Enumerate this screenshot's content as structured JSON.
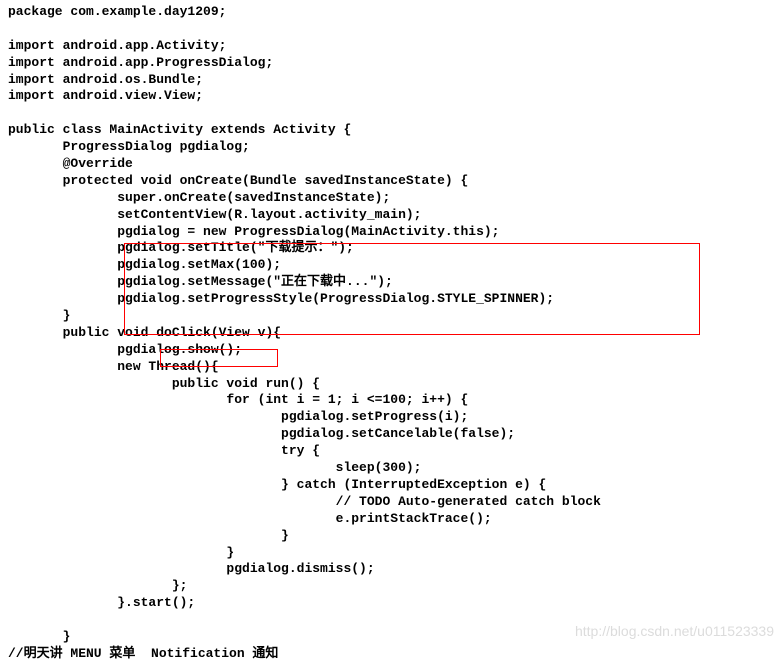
{
  "code": {
    "l1": "package com.example.day1209;",
    "l2": "",
    "l3": "import android.app.Activity;",
    "l4": "import android.app.ProgressDialog;",
    "l5": "import android.os.Bundle;",
    "l6": "import android.view.View;",
    "l7": "",
    "l8": "public class MainActivity extends Activity {",
    "l9": "       ProgressDialog pgdialog;",
    "l10": "       @Override",
    "l11": "       protected void onCreate(Bundle savedInstanceState) {",
    "l12": "              super.onCreate(savedInstanceState);",
    "l13": "              setContentView(R.layout.activity_main);",
    "l14": "              pgdialog = new ProgressDialog(MainActivity.this);",
    "l15": "              pgdialog.setTitle(\"下载提示：\");",
    "l16": "              pgdialog.setMax(100);",
    "l17": "              pgdialog.setMessage(\"正在下载中...\");",
    "l18": "              pgdialog.setProgressStyle(ProgressDialog.STYLE_SPINNER);",
    "l19": "       }",
    "l20": "       public void doClick(View v){",
    "l21": "              pgdialog.show();",
    "l22": "              new Thread(){",
    "l23": "                     public void run() {",
    "l24": "                            for (int i = 1; i <=100; i++) {",
    "l25": "                                   pgdialog.setProgress(i);",
    "l26": "                                   pgdialog.setCancelable(false);",
    "l27": "                                   try {",
    "l28": "                                          sleep(300);",
    "l29": "                                   } catch (InterruptedException e) {",
    "l30": "                                          // TODO Auto-generated catch block",
    "l31": "                                          e.printStackTrace();",
    "l32": "                                   }",
    "l33": "                            }",
    "l34": "                            pgdialog.dismiss();",
    "l35": "                     };",
    "l36": "              }.start();",
    "l37": "",
    "l38": "       }",
    "l39": "//明天讲 MENU 菜单  Notification 通知"
  },
  "watermark": "http://blog.csdn.net/u011523339"
}
